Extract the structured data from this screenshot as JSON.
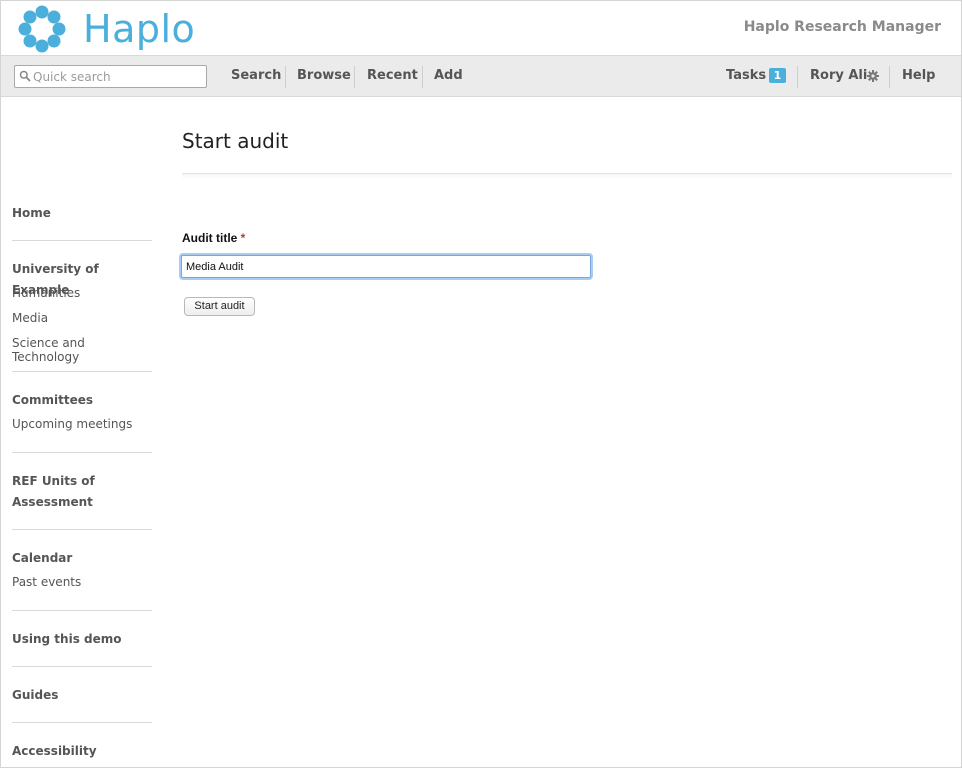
{
  "header": {
    "logo_text": "Haplo",
    "product_name": "Haplo Research Manager"
  },
  "toolbar": {
    "search_placeholder": "Quick search",
    "search_value": "",
    "nav": [
      "Search",
      "Browse",
      "Recent",
      "Add"
    ],
    "tasks_label": "Tasks",
    "tasks_count": "1",
    "user_name": "Rory Ali",
    "help_label": "Help"
  },
  "sidebar": {
    "sections": [
      {
        "heading": "Home",
        "links": []
      },
      {
        "heading": "University of Example",
        "links": [
          "Humanities",
          "Media",
          "Science and Technology"
        ]
      },
      {
        "heading": "Committees",
        "links": [
          "Upcoming meetings"
        ]
      },
      {
        "heading": "REF Units of Assessment",
        "links": []
      },
      {
        "heading": "Calendar",
        "links": [
          "Past events"
        ]
      },
      {
        "heading": "Using this demo",
        "links": []
      },
      {
        "heading": "Guides",
        "links": []
      },
      {
        "heading": "Accessibility",
        "links": []
      }
    ]
  },
  "main": {
    "title": "Start audit",
    "field_label": "Audit title",
    "required_marker": "*",
    "field_value": "Media Audit",
    "submit_label": "Start audit"
  },
  "colors": {
    "brand": "#4ab0db",
    "toolbar_bg": "#ebebeb",
    "required": "#c0392b"
  }
}
